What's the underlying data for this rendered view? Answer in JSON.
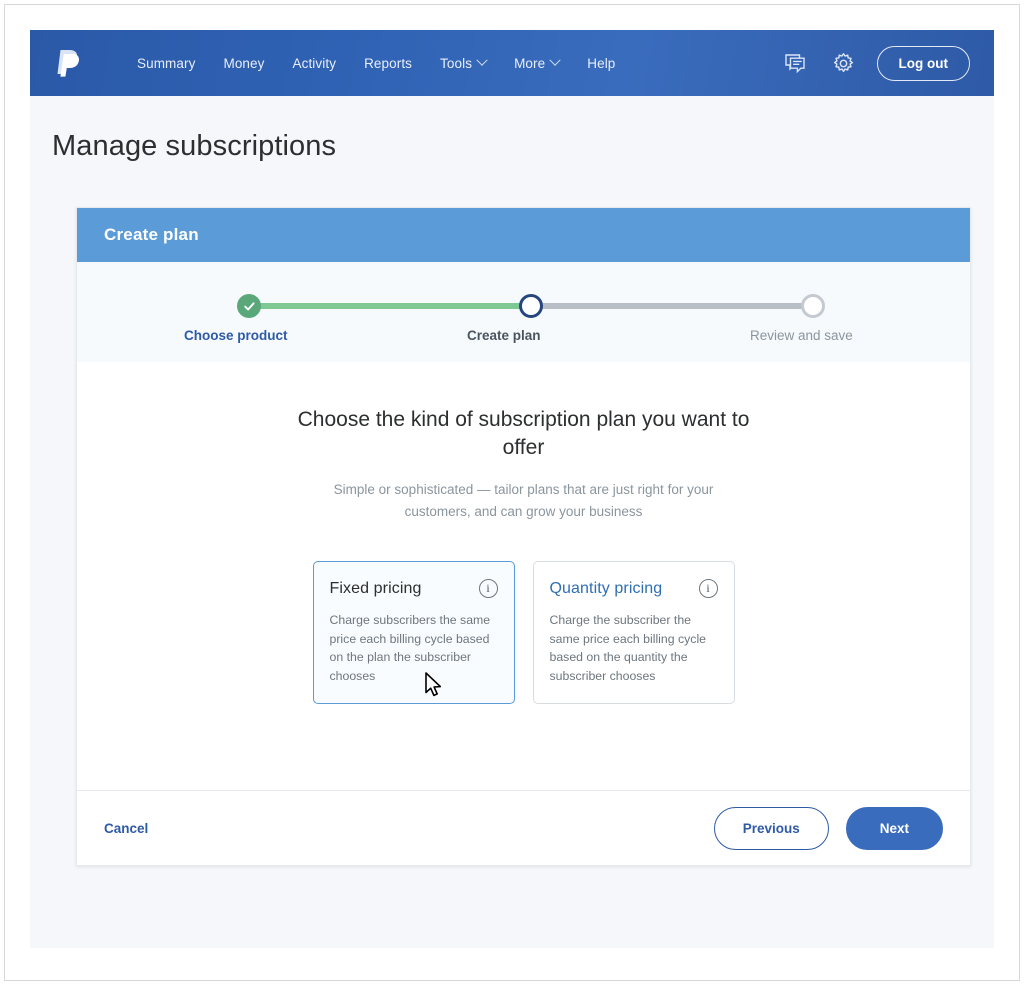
{
  "navbar": {
    "logo_icon": "paypal-logo-icon",
    "links": [
      {
        "label": "Summary",
        "has_caret": false
      },
      {
        "label": "Money",
        "has_caret": false
      },
      {
        "label": "Activity",
        "has_caret": false
      },
      {
        "label": "Reports",
        "has_caret": false
      },
      {
        "label": "Tools",
        "has_caret": true
      },
      {
        "label": "More",
        "has_caret": true
      },
      {
        "label": "Help",
        "has_caret": false
      }
    ],
    "message_icon": "chat-bubble-icon",
    "settings_icon": "gear-icon",
    "logout_label": "Log out",
    "background_color": "#2f62b4"
  },
  "page": {
    "title": "Manage subscriptions",
    "background_color": "#f5f7fa"
  },
  "card": {
    "header_title": "Create plan",
    "header_color": "#5b9bd8"
  },
  "stepper": {
    "steps": [
      {
        "label": "Choose product",
        "state": "completed"
      },
      {
        "label": "Create plan",
        "state": "current"
      },
      {
        "label": "Review and save",
        "state": "upcoming"
      }
    ],
    "completed_color": "#5aa87a",
    "track_done_color": "#7ec894",
    "track_todo_color": "#b7bec5",
    "current_ring_color": "#27467e"
  },
  "body": {
    "heading": "Choose the kind of subscription plan you want to offer",
    "subheading": "Simple or sophisticated — tailor plans that are just right for your customers, and can grow your business",
    "options": [
      {
        "title": "Fixed pricing",
        "description": "Charge subscribers the same price each billing cycle based on the plan the subscriber chooses",
        "info_icon": "info-circle-icon",
        "selected": true
      },
      {
        "title": "Quantity pricing",
        "description": "Charge the subscriber the same price each billing cycle based on the quantity the subscriber chooses",
        "info_icon": "info-circle-icon",
        "selected": false
      }
    ]
  },
  "footer": {
    "cancel_label": "Cancel",
    "previous_label": "Previous",
    "next_label": "Next",
    "next_color": "#3a6cbd"
  }
}
